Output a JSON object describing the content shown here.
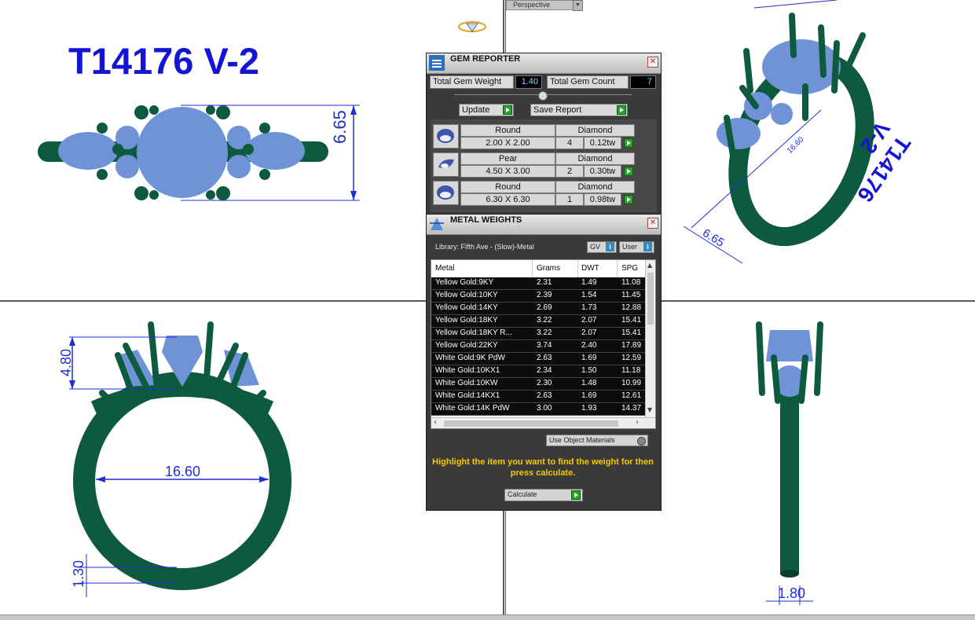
{
  "viewport": {
    "label": "Perspective"
  },
  "model": {
    "title": "T14176 V-2",
    "dims": {
      "top_height": "6.65",
      "front_height": "4.80",
      "ring_size": "16.60",
      "shank": "1.30",
      "side_width": "1.80",
      "persp_len": "16.60",
      "persp_h": "6.65"
    }
  },
  "gem_reporter": {
    "title": "GEM REPORTER",
    "total_weight_label": "Total Gem Weight",
    "total_weight_value": "1.40",
    "total_count_label": "Total Gem Count",
    "total_count_value": "7",
    "update_label": "Update",
    "save_label": "Save Report",
    "gems": [
      {
        "shape": "Round",
        "type": "Diamond",
        "size": "2.00 X 2.00",
        "count": "4",
        "weight": "0.12tw"
      },
      {
        "shape": "Pear",
        "type": "Diamond",
        "size": "4.50 X 3.00",
        "count": "2",
        "weight": "0.30tw"
      },
      {
        "shape": "Round",
        "type": "Diamond",
        "size": "6.30 X 6.30",
        "count": "1",
        "weight": "0.98tw"
      }
    ]
  },
  "metal_weights": {
    "title": "METAL WEIGHTS",
    "library": "Library: Fifth Ave - (Slow)-Metal",
    "gv_label": "GV",
    "user_label": "User",
    "columns": [
      "Metal",
      "Grams",
      "DWT",
      "SPG"
    ],
    "rows": [
      [
        "Yellow Gold:9KY",
        "2.31",
        "1.49",
        "11.08"
      ],
      [
        "Yellow Gold:10KY",
        "2.39",
        "1.54",
        "11.45"
      ],
      [
        "Yellow Gold:14KY",
        "2.69",
        "1.73",
        "12.88"
      ],
      [
        "Yellow Gold:18KY",
        "3.22",
        "2.07",
        "15.41"
      ],
      [
        "Yellow Gold:18KY R...",
        "3.22",
        "2.07",
        "15.41"
      ],
      [
        "Yellow Gold:22KY",
        "3.74",
        "2.40",
        "17.89"
      ],
      [
        "White Gold:9K PdW",
        "2.63",
        "1.69",
        "12.59"
      ],
      [
        "White Gold:10KX1",
        "2.34",
        "1.50",
        "11.18"
      ],
      [
        "White Gold:10KW",
        "2.30",
        "1.48",
        "10.99"
      ],
      [
        "White Gold:14KX1",
        "2.63",
        "1.69",
        "12.61"
      ],
      [
        "White Gold:14K PdW",
        "3.00",
        "1.93",
        "14.37"
      ]
    ],
    "use_object_materials": "Use Object Materials",
    "hint": "Highlight the item you want to find the weight for then press calculate.",
    "calculate_label": "Calculate"
  },
  "colors": {
    "metal": "#0e5a3e",
    "gem": "#6f93d6",
    "dimension": "#1f2fd6",
    "panel": "#3a3a3a",
    "hint": "#f5c800"
  }
}
